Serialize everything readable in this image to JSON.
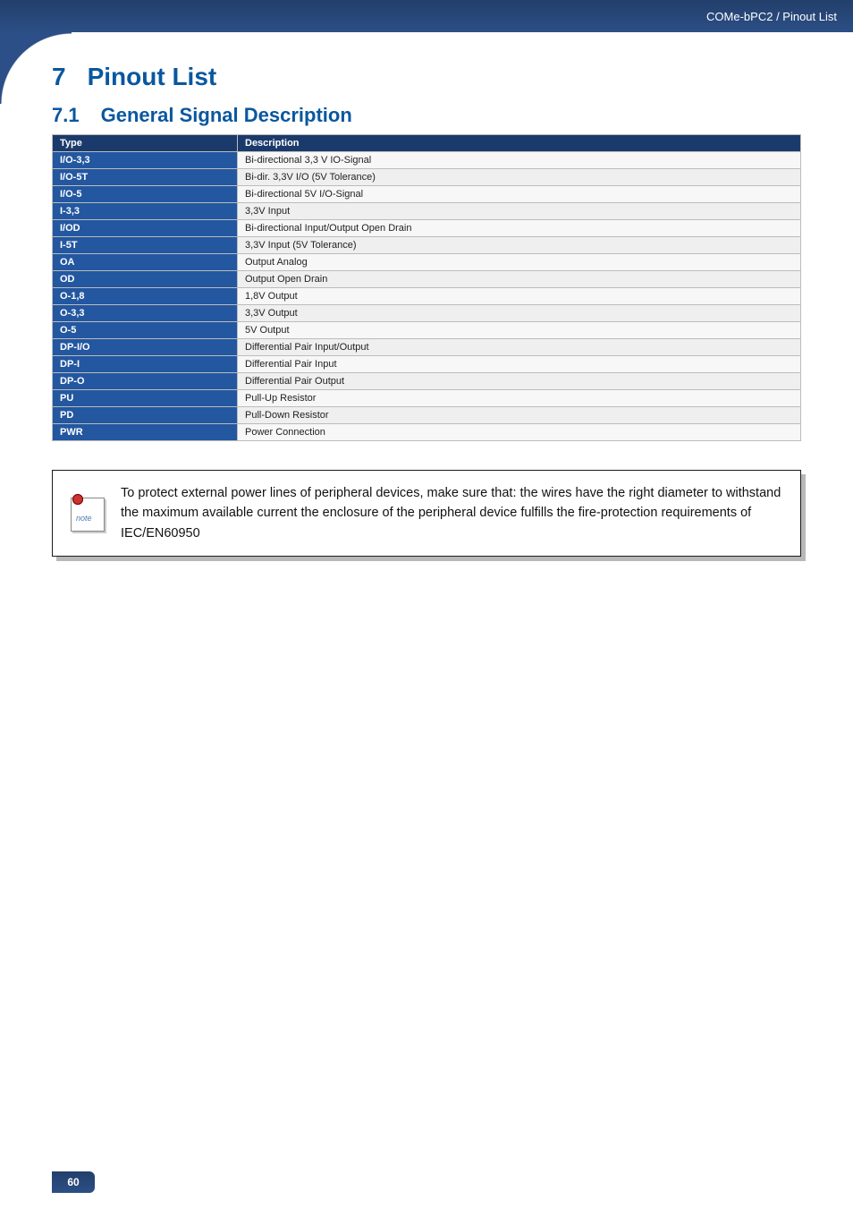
{
  "header": {
    "breadcrumb": "COMe-bPC2 / Pinout List"
  },
  "chapter": {
    "number": "7",
    "title": "Pinout List"
  },
  "section": {
    "number": "7.1",
    "title": "General Signal Description"
  },
  "table": {
    "headers": {
      "type": "Type",
      "description": "Description"
    },
    "rows": [
      {
        "type": "I/O-3,3",
        "desc": "Bi-directional 3,3 V IO-Signal"
      },
      {
        "type": "I/O-5T",
        "desc": "Bi-dir. 3,3V I/O (5V Tolerance)"
      },
      {
        "type": "I/O-5",
        "desc": "Bi-directional 5V I/O-Signal"
      },
      {
        "type": "I-3,3",
        "desc": "3,3V Input"
      },
      {
        "type": "I/OD",
        "desc": "Bi-directional Input/Output Open Drain"
      },
      {
        "type": "I-5T",
        "desc": "3,3V Input (5V Tolerance)"
      },
      {
        "type": "OA",
        "desc": "Output Analog"
      },
      {
        "type": "OD",
        "desc": "Output Open Drain"
      },
      {
        "type": "O-1,8",
        "desc": "1,8V Output"
      },
      {
        "type": "O-3,3",
        "desc": "3,3V Output"
      },
      {
        "type": "O-5",
        "desc": "5V Output"
      },
      {
        "type": "DP-I/O",
        "desc": "Differential Pair Input/Output"
      },
      {
        "type": "DP-I",
        "desc": "Differential Pair Input"
      },
      {
        "type": "DP-O",
        "desc": "Differential Pair Output"
      },
      {
        "type": "PU",
        "desc": "Pull-Up Resistor"
      },
      {
        "type": "PD",
        "desc": "Pull-Down Resistor"
      },
      {
        "type": "PWR",
        "desc": "Power Connection"
      }
    ]
  },
  "note": {
    "icon_label": "note",
    "text": "To protect external power lines of peripheral devices, make sure that: the wires have the right diameter to withstand the maximum available current the enclosure of the peripheral device fulfills the fire-protection requirements of IEC/EN60950"
  },
  "footer": {
    "page_number": "60"
  }
}
